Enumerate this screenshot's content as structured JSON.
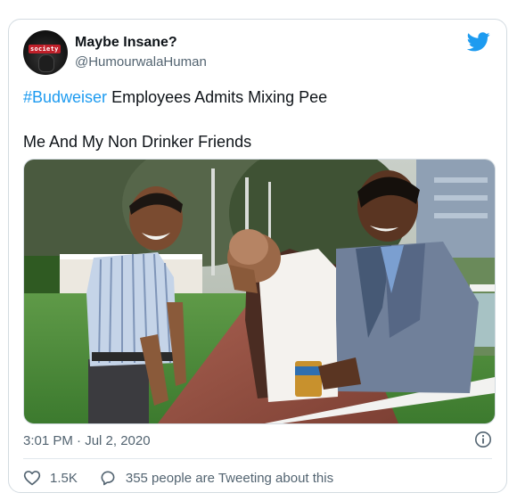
{
  "tweet": {
    "author": {
      "avatar_badge": "society",
      "name": "Maybe Insane?",
      "handle": "@HumourwalaHuman"
    },
    "text": {
      "hashtag": "#Budweiser",
      "line1_rest": " Employees Admits Mixing Pee",
      "line2": "Me And My Non Drinker Friends"
    },
    "timestamp": "3:01 PM · Jul 2, 2020",
    "likes": "1.5K",
    "conversation": "355 people are Tweeting about this"
  },
  "colors": {
    "brand_blue": "#1d9bf0",
    "text_primary": "#0f1419",
    "text_secondary": "#536471",
    "border": "#d3dbe1"
  },
  "icons": {
    "brand": "twitter-bird-icon",
    "info": "info-icon",
    "like": "heart-icon",
    "reply": "speech-bubble-icon"
  }
}
